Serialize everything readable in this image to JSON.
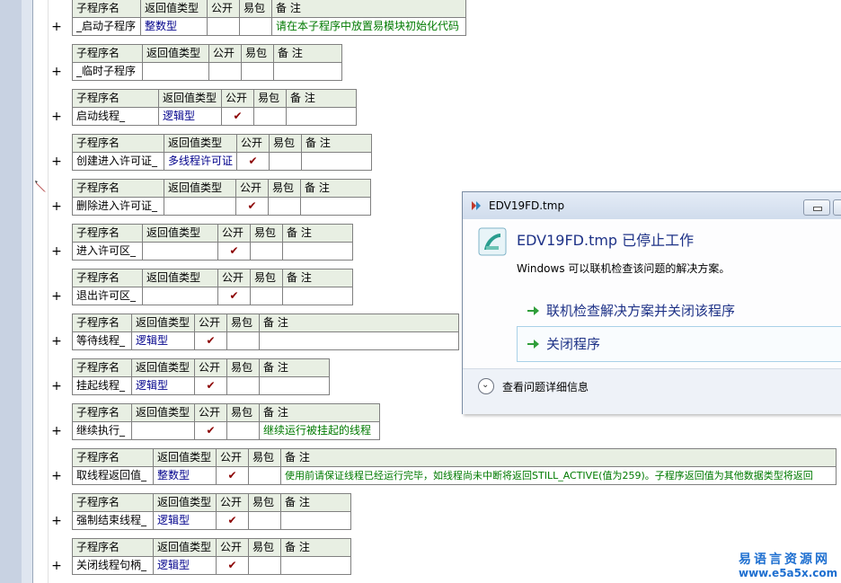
{
  "headers": {
    "name": "子程序名",
    "rtype": "返回值类型",
    "public": "公开",
    "easy": "易包",
    "note": "备 注"
  },
  "check": "✔",
  "subs": [
    {
      "name": "_启动子程序",
      "rtype": "整数型",
      "public": "",
      "easy": "",
      "note": "请在本子程序中放置易模块初始化代码"
    },
    {
      "name": "_临时子程序",
      "rtype": "",
      "public": "",
      "easy": "",
      "note": ""
    },
    {
      "name": "启动线程_",
      "rtype": "逻辑型",
      "public": "✔",
      "easy": "",
      "note": ""
    },
    {
      "name": "创建进入许可证_",
      "rtype": "多线程许可证",
      "public": "✔",
      "easy": "",
      "note": ""
    },
    {
      "name": "删除进入许可证_",
      "rtype": "",
      "public": "✔",
      "easy": "",
      "note": ""
    },
    {
      "name": "进入许可区_",
      "rtype": "",
      "public": "✔",
      "easy": "",
      "note": ""
    },
    {
      "name": "退出许可区_",
      "rtype": "",
      "public": "✔",
      "easy": "",
      "note": ""
    },
    {
      "name": "等待线程_",
      "rtype": "逻辑型",
      "public": "✔",
      "easy": "",
      "note": ""
    },
    {
      "name": "挂起线程_",
      "rtype": "逻辑型",
      "public": "✔",
      "easy": "",
      "note": ""
    },
    {
      "name": "继续执行_",
      "rtype": "",
      "public": "✔",
      "easy": "",
      "note": "继续运行被挂起的线程"
    },
    {
      "name": "取线程返回值_",
      "rtype": "整数型",
      "public": "✔",
      "easy": "",
      "note": "使用前请保证线程已经运行完毕，如线程尚未中断将返回STILL_ACTIVE(值为259)。子程序返回值为其他数据类型将返回"
    },
    {
      "name": "强制结束线程_",
      "rtype": "逻辑型",
      "public": "✔",
      "easy": "",
      "note": ""
    },
    {
      "name": "关闭线程句柄_",
      "rtype": "逻辑型",
      "public": "✔",
      "easy": "",
      "note": ""
    }
  ],
  "dialog": {
    "title": "EDV19FD.tmp",
    "heading": "EDV19FD.tmp 已停止工作",
    "subtitle": "Windows 可以联机检查该问题的解决方案。",
    "option1": "联机检查解决方案并关闭该程序",
    "option2": "关闭程序",
    "details": "查看问题详细信息"
  },
  "watermark": {
    "line1": "易语言资源网",
    "line2": "www.e5a5x.com"
  },
  "colors": {
    "header_bg": "#e8efe3",
    "type_text": "#00008b",
    "note_text": "#007a00",
    "check": "#8b0000",
    "dialog_heading": "#1e3287",
    "watermark": "#1e6fd0"
  }
}
